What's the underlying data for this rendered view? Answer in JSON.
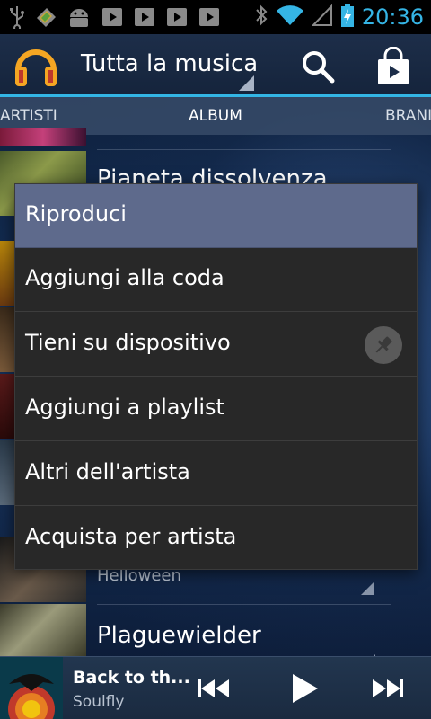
{
  "status_bar": {
    "time": "20:36"
  },
  "action_bar": {
    "title": "Tutta la musica"
  },
  "tabs": {
    "artists": "ARTISTI",
    "album": "ALBUM",
    "songs": "BRANI"
  },
  "albums": [
    {
      "title": "Pianeta dissolvenza"
    },
    {
      "artist": "Helloween"
    },
    {
      "title": "Plaguewielder"
    }
  ],
  "context_menu": {
    "items": [
      {
        "label": "Riproduci",
        "selected": true
      },
      {
        "label": "Aggiungi alla coda"
      },
      {
        "label": "Tieni su dispositivo",
        "icon": "pin-icon"
      },
      {
        "label": "Aggiungi a playlist"
      },
      {
        "label": "Altri dell'artista"
      },
      {
        "label": "Acquista per artista"
      }
    ]
  },
  "now_playing": {
    "title": "Back to th...",
    "artist": "Soulfly"
  },
  "colors": {
    "accent": "#33b5e5",
    "menu_selected": "#5e6a8c",
    "menu_bg": "#282828"
  }
}
